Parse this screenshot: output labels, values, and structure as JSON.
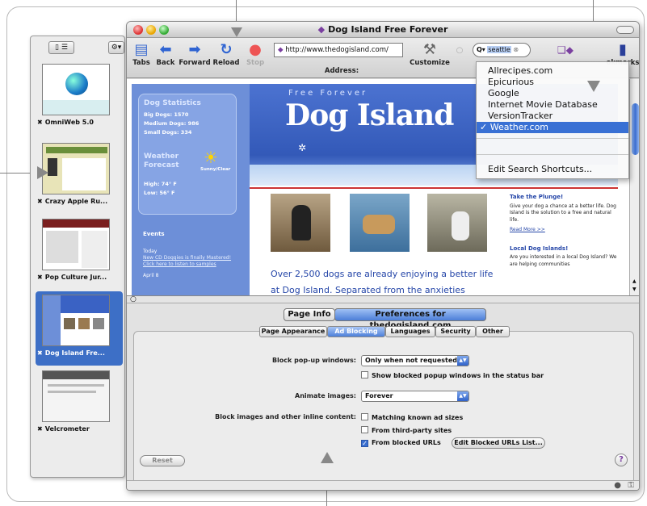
{
  "drawer": {
    "items": [
      {
        "label": "OmniWeb 5.0"
      },
      {
        "label": "Crazy Apple Ru..."
      },
      {
        "label": "Pop Culture Jur..."
      },
      {
        "label": "Dog Island Fre..."
      },
      {
        "label": "Velcrometer"
      }
    ],
    "close_glyph": "✖"
  },
  "window": {
    "title": "Dog Island Free Forever"
  },
  "toolbar": {
    "tabs": "Tabs",
    "back": "Back",
    "forward": "Forward",
    "reload": "Reload",
    "stop": "Stop",
    "address_label": "Address:",
    "address_value": "http://www.thedogisland.com/",
    "customize": "Customize",
    "bookmarks": "okmarks",
    "search_prefix": "Q▾",
    "search_value": "seattle"
  },
  "search_menu": {
    "items": [
      "Allrecipes.com",
      "Epicurious",
      "Google",
      "Internet Movie Database",
      "VersionTracker"
    ],
    "checked": "Weather.com",
    "edit": "Edit Search Shortcuts..."
  },
  "webpage": {
    "stats_title": "Dog Statistics",
    "big_dogs": "Big Dogs: 1570",
    "medium_dogs": "Medium Dogs: 986",
    "small_dogs": "Small Dogs: 334",
    "weather_title": "Weather",
    "weather_title2": "Forecast",
    "sunny": "Sunny/Clear",
    "high": "High: 74° F",
    "low": "Low: 56° F",
    "events": "Events",
    "today": "Today",
    "event_link": "New CD Doggies is finally Mastered! Click here to listen to samples",
    "april": "April 8",
    "banner_small": "Free Forever",
    "banner_big": "Dog Island",
    "teaser": "Over 2,500 dogs are already enjoying a better life at Dog Island. Separated from the anxieties",
    "plunge_title": "Take the Plunge!",
    "plunge_text": "Give your dog a chance at a better life. Dog Island is the solution to a free and natural life.",
    "read_more": "Read More >>",
    "local_title": "Local Dog Islands!",
    "local_text": "Are you interested in a local Dog Island? We are helping communities"
  },
  "prefs": {
    "seg_info": "Page Info",
    "seg_prefs": "Preferences for thedogisland.com",
    "tabs": [
      "Page Appearance",
      "Ad Blocking",
      "Languages",
      "Security",
      "Other"
    ],
    "popup_label": "Block pop-up windows:",
    "popup_value": "Only when not requested",
    "show_blocked": "Show blocked popup windows in the status bar",
    "animate_label": "Animate images:",
    "animate_value": "Forever",
    "block_label": "Block images and other inline content:",
    "opt_ad_sizes": "Matching known ad sizes",
    "opt_third": "From third-party sites",
    "opt_blocked": "From blocked URLs",
    "edit_list": "Edit Blocked URLs List...",
    "reset": "Reset",
    "help": "?"
  }
}
